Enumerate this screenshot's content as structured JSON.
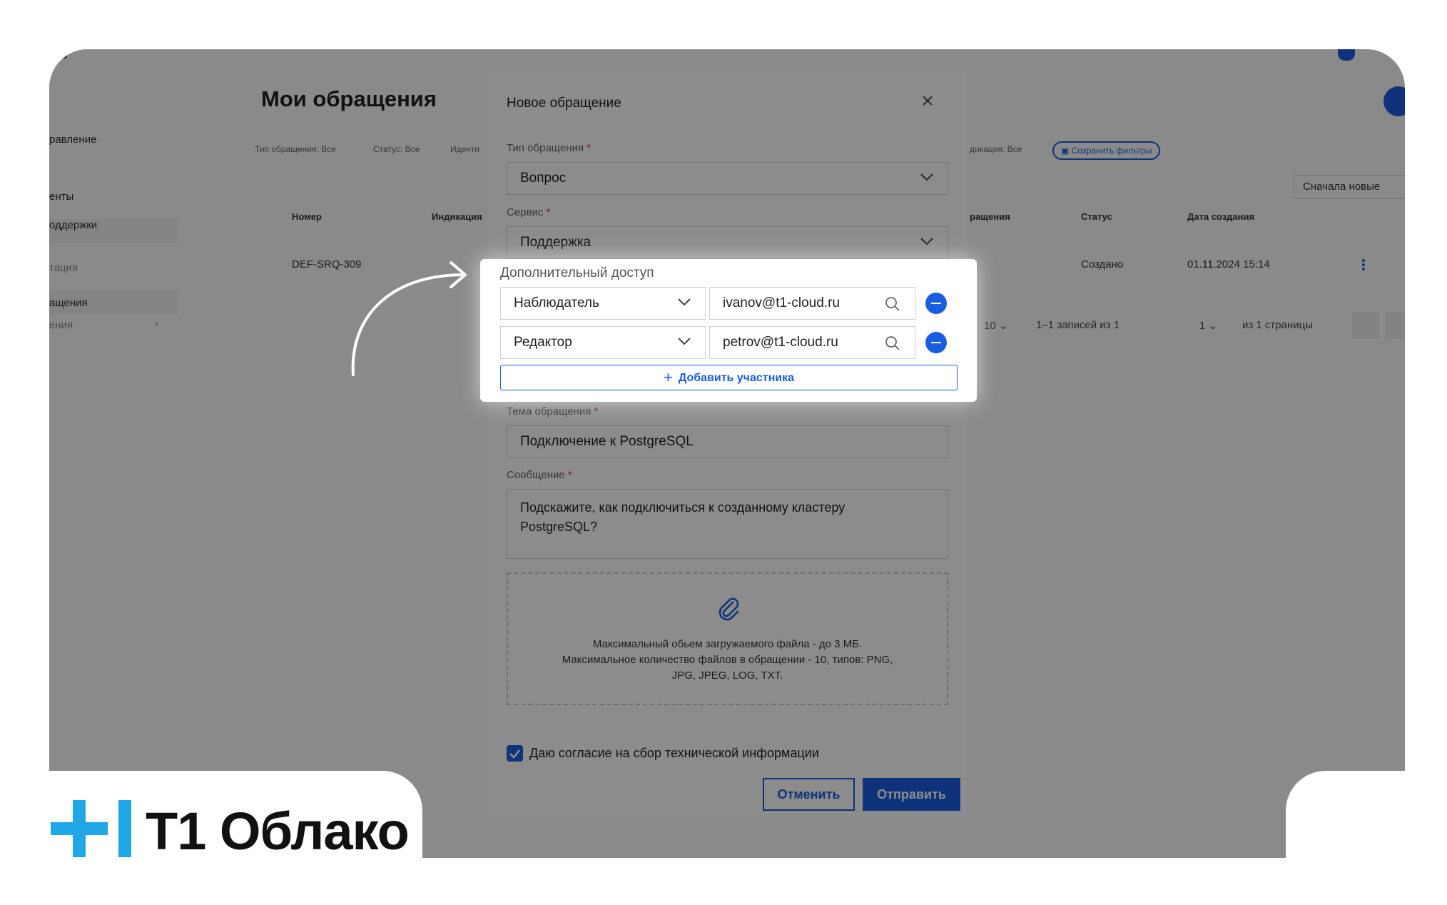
{
  "app": {
    "logo_crumb": "ко",
    "page_title": "Мои обращения",
    "sidebar": [
      {
        "label": "равление"
      },
      {
        "label": "енты"
      },
      {
        "label": "оддержки"
      },
      {
        "label": "тация"
      },
      {
        "label": "ащения"
      },
      {
        "label": "ения"
      }
    ],
    "filters": {
      "type": "Тип обращения: Все",
      "status": "Статус: Все",
      "ident": "Иденти",
      "indication": "дикация: Все",
      "save": "Сохранить фильтры"
    },
    "sort": "Сначала новые",
    "table": {
      "headers": [
        "Номер",
        "Индикация",
        "ращения",
        "Статус",
        "Дата создания"
      ],
      "row": {
        "number": "DEF-SRQ-309",
        "status": "Создано",
        "date": "01.11.2024 15:14"
      }
    },
    "pager": {
      "per_page": "10",
      "records": "1–1 записей из 1",
      "page": "1",
      "pages": "из 1 страницы"
    }
  },
  "modal": {
    "title": "Новое обращение",
    "type_label": "Тип обращения",
    "type_value": "Вопрос",
    "service_label": "Сервис",
    "service_value": "Поддержка",
    "topic_label": "Тема обращения",
    "topic_value": "Подключение к PostgreSQL",
    "message_label": "Сообщение",
    "message_value": "Подскажите, как подключиться к созданному кластеру PostgreSQL?",
    "upload_line1": "Максимальный обьем загружаемого файла - до 3 МБ.",
    "upload_line2": "Максимальное количество файлов в обращении - 10, типов: PNG,",
    "upload_line3": "JPG, JPEG, LOG, TXT.",
    "consent": "Даю согласие на сбор технической информации",
    "cancel": "Отменить",
    "send": "Отправить",
    "required_mark": "*"
  },
  "access": {
    "title": "Дополнительный доступ",
    "participants": [
      {
        "role": "Наблюдатель",
        "email": "ivanov@t1-cloud.ru"
      },
      {
        "role": "Редактор",
        "email": "petrov@t1-cloud.ru"
      }
    ],
    "add_label": "Добавить участника"
  },
  "brand": {
    "name": "T1 Облако",
    "color": "#1fa7e8"
  },
  "colors": {
    "accent": "#1a5de0",
    "required": "#e0302a"
  }
}
